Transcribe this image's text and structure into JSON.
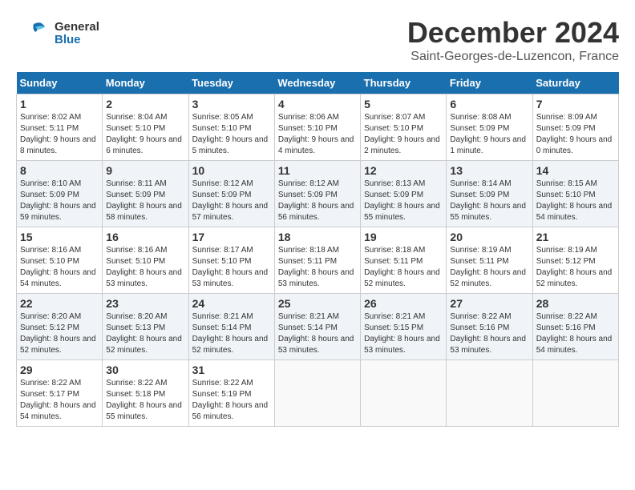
{
  "header": {
    "logo_general": "General",
    "logo_blue": "Blue",
    "month": "December 2024",
    "location": "Saint-Georges-de-Luzencon, France"
  },
  "weekdays": [
    "Sunday",
    "Monday",
    "Tuesday",
    "Wednesday",
    "Thursday",
    "Friday",
    "Saturday"
  ],
  "weeks": [
    [
      {
        "day": "1",
        "sunrise": "8:02 AM",
        "sunset": "5:11 PM",
        "daylight": "9 hours and 8 minutes."
      },
      {
        "day": "2",
        "sunrise": "8:04 AM",
        "sunset": "5:10 PM",
        "daylight": "9 hours and 6 minutes."
      },
      {
        "day": "3",
        "sunrise": "8:05 AM",
        "sunset": "5:10 PM",
        "daylight": "9 hours and 5 minutes."
      },
      {
        "day": "4",
        "sunrise": "8:06 AM",
        "sunset": "5:10 PM",
        "daylight": "9 hours and 4 minutes."
      },
      {
        "day": "5",
        "sunrise": "8:07 AM",
        "sunset": "5:10 PM",
        "daylight": "9 hours and 2 minutes."
      },
      {
        "day": "6",
        "sunrise": "8:08 AM",
        "sunset": "5:09 PM",
        "daylight": "9 hours and 1 minute."
      },
      {
        "day": "7",
        "sunrise": "8:09 AM",
        "sunset": "5:09 PM",
        "daylight": "9 hours and 0 minutes."
      }
    ],
    [
      {
        "day": "8",
        "sunrise": "8:10 AM",
        "sunset": "5:09 PM",
        "daylight": "8 hours and 59 minutes."
      },
      {
        "day": "9",
        "sunrise": "8:11 AM",
        "sunset": "5:09 PM",
        "daylight": "8 hours and 58 minutes."
      },
      {
        "day": "10",
        "sunrise": "8:12 AM",
        "sunset": "5:09 PM",
        "daylight": "8 hours and 57 minutes."
      },
      {
        "day": "11",
        "sunrise": "8:12 AM",
        "sunset": "5:09 PM",
        "daylight": "8 hours and 56 minutes."
      },
      {
        "day": "12",
        "sunrise": "8:13 AM",
        "sunset": "5:09 PM",
        "daylight": "8 hours and 55 minutes."
      },
      {
        "day": "13",
        "sunrise": "8:14 AM",
        "sunset": "5:09 PM",
        "daylight": "8 hours and 55 minutes."
      },
      {
        "day": "14",
        "sunrise": "8:15 AM",
        "sunset": "5:10 PM",
        "daylight": "8 hours and 54 minutes."
      }
    ],
    [
      {
        "day": "15",
        "sunrise": "8:16 AM",
        "sunset": "5:10 PM",
        "daylight": "8 hours and 54 minutes."
      },
      {
        "day": "16",
        "sunrise": "8:16 AM",
        "sunset": "5:10 PM",
        "daylight": "8 hours and 53 minutes."
      },
      {
        "day": "17",
        "sunrise": "8:17 AM",
        "sunset": "5:10 PM",
        "daylight": "8 hours and 53 minutes."
      },
      {
        "day": "18",
        "sunrise": "8:18 AM",
        "sunset": "5:11 PM",
        "daylight": "8 hours and 53 minutes."
      },
      {
        "day": "19",
        "sunrise": "8:18 AM",
        "sunset": "5:11 PM",
        "daylight": "8 hours and 52 minutes."
      },
      {
        "day": "20",
        "sunrise": "8:19 AM",
        "sunset": "5:11 PM",
        "daylight": "8 hours and 52 minutes."
      },
      {
        "day": "21",
        "sunrise": "8:19 AM",
        "sunset": "5:12 PM",
        "daylight": "8 hours and 52 minutes."
      }
    ],
    [
      {
        "day": "22",
        "sunrise": "8:20 AM",
        "sunset": "5:12 PM",
        "daylight": "8 hours and 52 minutes."
      },
      {
        "day": "23",
        "sunrise": "8:20 AM",
        "sunset": "5:13 PM",
        "daylight": "8 hours and 52 minutes."
      },
      {
        "day": "24",
        "sunrise": "8:21 AM",
        "sunset": "5:14 PM",
        "daylight": "8 hours and 52 minutes."
      },
      {
        "day": "25",
        "sunrise": "8:21 AM",
        "sunset": "5:14 PM",
        "daylight": "8 hours and 53 minutes."
      },
      {
        "day": "26",
        "sunrise": "8:21 AM",
        "sunset": "5:15 PM",
        "daylight": "8 hours and 53 minutes."
      },
      {
        "day": "27",
        "sunrise": "8:22 AM",
        "sunset": "5:16 PM",
        "daylight": "8 hours and 53 minutes."
      },
      {
        "day": "28",
        "sunrise": "8:22 AM",
        "sunset": "5:16 PM",
        "daylight": "8 hours and 54 minutes."
      }
    ],
    [
      {
        "day": "29",
        "sunrise": "8:22 AM",
        "sunset": "5:17 PM",
        "daylight": "8 hours and 54 minutes."
      },
      {
        "day": "30",
        "sunrise": "8:22 AM",
        "sunset": "5:18 PM",
        "daylight": "8 hours and 55 minutes."
      },
      {
        "day": "31",
        "sunrise": "8:22 AM",
        "sunset": "5:19 PM",
        "daylight": "8 hours and 56 minutes."
      },
      null,
      null,
      null,
      null
    ]
  ]
}
